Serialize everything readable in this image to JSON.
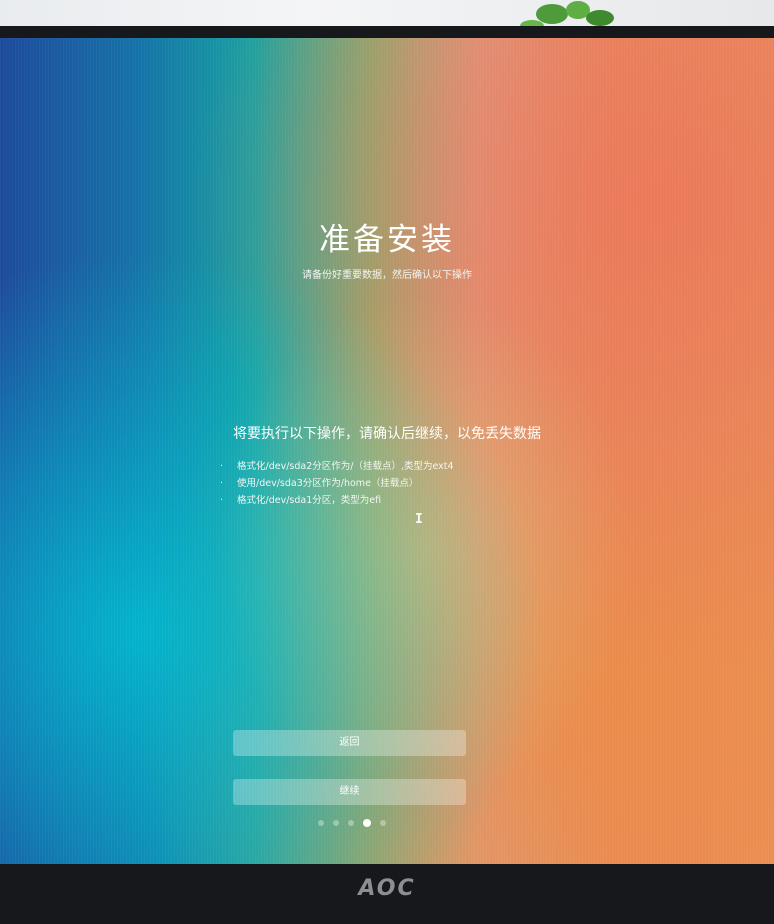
{
  "installer": {
    "title": "准备安装",
    "subtitle": "请备份好重要数据，然后确认以下操作",
    "operations_heading": "将要执行以下操作，请确认后继续，以免丢失数据",
    "operations": [
      {
        "bullet": "·",
        "text": "格式化/dev/sda2分区作为/（挂载点）,类型为ext4"
      },
      {
        "bullet": "·",
        "text": "使用/dev/sda3分区作为/home（挂载点）"
      },
      {
        "bullet": "·",
        "text": "格式化/dev/sda1分区，类型为efi"
      }
    ],
    "back_label": "返回",
    "continue_label": "继续",
    "progress": {
      "total_steps": 5,
      "current_step": 4
    }
  },
  "monitor": {
    "brand": "AOC"
  },
  "cursor": {
    "glyph": "I",
    "icon": "text-cursor-icon"
  },
  "colors": {
    "text": "#ffffff",
    "button_bg": "rgba(255,255,255,0.30)",
    "bezel": "#16181b"
  }
}
